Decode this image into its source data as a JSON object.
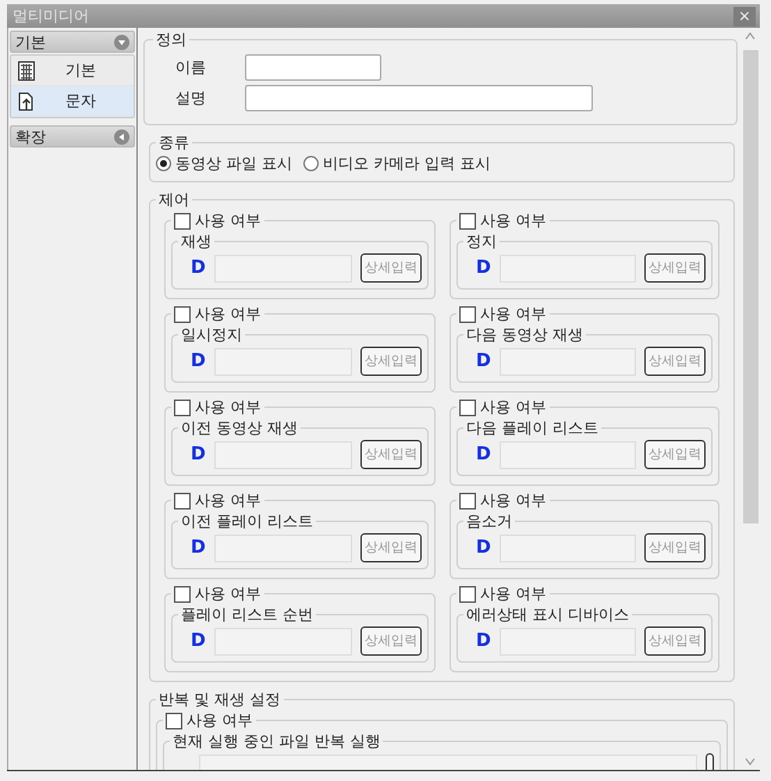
{
  "window": {
    "title": "멀티미디어",
    "close": "×"
  },
  "sidebar": {
    "sections": [
      {
        "label": "기본",
        "expanded": true,
        "items": [
          {
            "label": "기본",
            "selected": false
          },
          {
            "label": "문자",
            "selected": true
          }
        ]
      },
      {
        "label": "확장",
        "expanded": false
      }
    ]
  },
  "definition": {
    "title": "정의",
    "fields": [
      {
        "label": "이름"
      },
      {
        "label": "설명"
      }
    ]
  },
  "display_type": {
    "title": "종류",
    "options": [
      {
        "label": "동영상 파일 표시",
        "selected": true
      },
      {
        "label": "비디오 카메라 입력 표시",
        "selected": false
      }
    ]
  },
  "control": {
    "title": "제어",
    "items": [
      {
        "enable_label": "사용 여부",
        "checked": false,
        "title": "재생",
        "device": "D",
        "button": "상세입력"
      },
      {
        "enable_label": "사용 여부",
        "checked": false,
        "title": "정지",
        "device": "D",
        "button": "상세입력"
      },
      {
        "enable_label": "사용 여부",
        "checked": false,
        "title": "일시정지",
        "device": "D",
        "button": "상세입력"
      },
      {
        "enable_label": "사용 여부",
        "checked": false,
        "title": "다음 동영상 재생",
        "device": "D",
        "button": "상세입력"
      },
      {
        "enable_label": "사용 여부",
        "checked": false,
        "title": "이전 동영상 재생",
        "device": "D",
        "button": "상세입력"
      },
      {
        "enable_label": "사용 여부",
        "checked": false,
        "title": "다음 플레이 리스트",
        "device": "D",
        "button": "상세입력"
      },
      {
        "enable_label": "사용 여부",
        "checked": false,
        "title": "이전 플레이 리스트",
        "device": "D",
        "button": "상세입력"
      },
      {
        "enable_label": "사용 여부",
        "checked": false,
        "title": "음소거",
        "device": "D",
        "button": "상세입력"
      },
      {
        "enable_label": "사용 여부",
        "checked": false,
        "title": "플레이 리스트 순번",
        "device": "D",
        "button": "상세입력"
      },
      {
        "enable_label": "사용 여부",
        "checked": false,
        "title": "에러상태 표시 디바이스",
        "device": "D",
        "button": "상세입력"
      }
    ]
  },
  "repeat": {
    "title": "반복 및 재생 설정",
    "items": [
      {
        "enable_label": "사용 여부",
        "checked": false,
        "title": "현재 실행 중인 파일 반복 실행"
      }
    ]
  }
}
